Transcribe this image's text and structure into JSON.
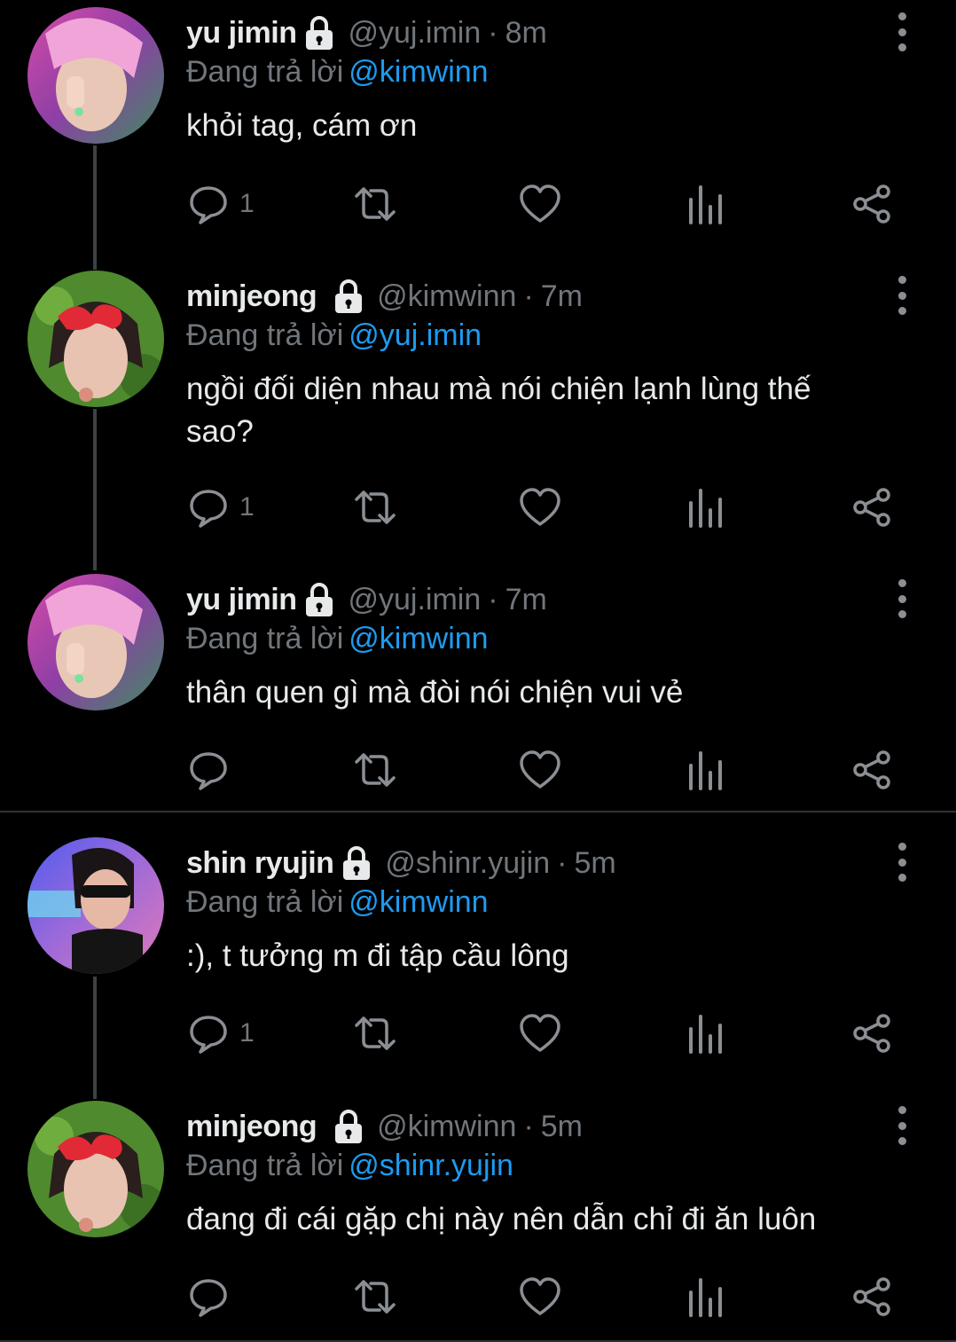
{
  "reply_prefix": "Đang trả lời",
  "tweets": [
    {
      "name": "yu jimin",
      "handle": "@yuj.imin",
      "separator": "·",
      "time": "8m",
      "reply_to": "@kimwinn",
      "text": "khỏi tag, cám ơn",
      "reply_count": "1",
      "avatar_style": "pink-hair"
    },
    {
      "name": "minjeong",
      "handle": "@kimwinn",
      "separator": "·",
      "time": "7m",
      "reply_to": "@yuj.imin",
      "text": "ngồi đối diện nhau mà nói chiện lạnh lùng thế sao?",
      "reply_count": "1",
      "avatar_style": "heart-glasses"
    },
    {
      "name": "yu jimin",
      "handle": "@yuj.imin",
      "separator": "·",
      "time": "7m",
      "reply_to": "@kimwinn",
      "text": "thân quen gì mà đòi nói chiện vui vẻ",
      "reply_count": "",
      "avatar_style": "pink-hair"
    },
    {
      "name": "shin ryujin",
      "handle": "@shinr.yujin",
      "separator": "·",
      "time": "5m",
      "reply_to": "@kimwinn",
      "text": ":), t tưởng m đi tập cầu lông",
      "reply_count": "1",
      "avatar_style": "sunglasses"
    },
    {
      "name": "minjeong",
      "handle": "@kimwinn",
      "separator": "·",
      "time": "5m",
      "reply_to": "@shinr.yujin",
      "text": "đang đi cái gặp chị này nên dẫn chỉ đi ăn luôn",
      "reply_count": "",
      "avatar_style": "heart-glasses"
    }
  ],
  "icons": {
    "lock": "lock-icon",
    "more": "more-vertical-icon",
    "reply": "reply-icon",
    "retweet": "retweet-icon",
    "like": "heart-icon",
    "views": "views-icon",
    "share": "share-icon"
  },
  "colors": {
    "background": "#000000",
    "text": "#e7e9ea",
    "muted": "#71767b",
    "mention": "#1d9bf0",
    "thread_line": "#3e4144",
    "divider": "#2f3336"
  }
}
